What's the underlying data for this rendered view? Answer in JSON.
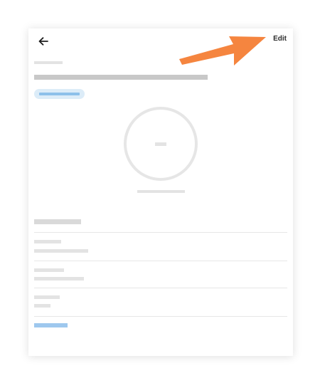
{
  "header": {
    "back_icon": "arrow-left-icon",
    "edit_label": "Edit"
  },
  "annotation": {
    "arrow_color": "#f5853f"
  },
  "colors": {
    "accent_light": "#dcecf8",
    "accent": "#8dc0ea"
  }
}
